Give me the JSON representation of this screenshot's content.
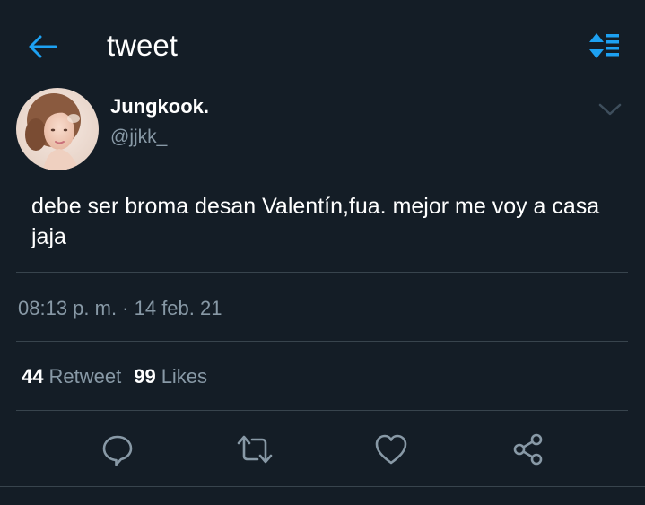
{
  "header": {
    "title": "tweet",
    "back_icon": "arrow-left-icon",
    "sort_icon": "sort-list-icon",
    "accent_color": "#1da1f2"
  },
  "tweet": {
    "author": {
      "display_name": "Jungkook.",
      "handle": "@jjkk_"
    },
    "text": "debe ser broma desan Valentín,fua. mejor me voy a casa jaja",
    "timestamp": "08:13 p. m. · 14 feb. 21",
    "stats": {
      "retweets_count": "44",
      "retweets_label": "Retweet",
      "likes_count": "99",
      "likes_label": "Likes"
    },
    "actions": [
      {
        "name": "reply",
        "icon": "speech-bubble-icon"
      },
      {
        "name": "retweet",
        "icon": "retweet-icon"
      },
      {
        "name": "like",
        "icon": "heart-icon"
      },
      {
        "name": "share",
        "icon": "share-icon"
      }
    ]
  },
  "colors": {
    "background": "#141d26",
    "divider": "#38444d",
    "secondary_text": "#8899a6",
    "icon_gray": "#8899a6"
  }
}
